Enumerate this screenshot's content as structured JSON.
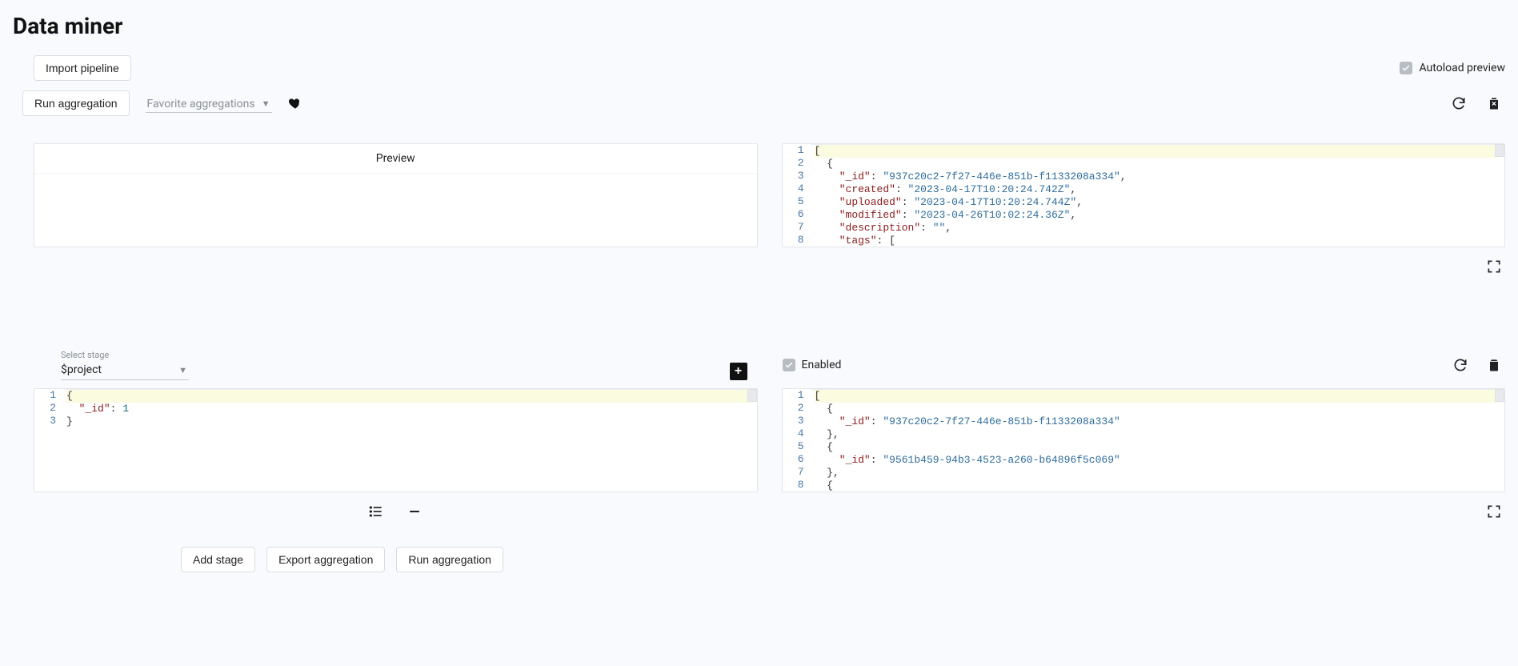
{
  "page_title": "Data miner",
  "toolbar": {
    "import_label": "Import pipeline",
    "run_label": "Run aggregation",
    "fav_placeholder": "Favorite aggregations",
    "autoload_label": "Autoload preview",
    "autoload_checked": true
  },
  "preview_panel": {
    "header": "Preview"
  },
  "result_preview_code": {
    "lines": [
      {
        "n": 1,
        "t": "[",
        "indent": 0
      },
      {
        "n": 2,
        "t": "{",
        "indent": 1
      },
      {
        "n": 3,
        "key": "_id",
        "val": "937c20c2-7f27-446e-851b-f1133208a334",
        "comma": true,
        "indent": 2
      },
      {
        "n": 4,
        "key": "created",
        "val": "2023-04-17T10:20:24.742Z",
        "comma": true,
        "indent": 2
      },
      {
        "n": 5,
        "key": "uploaded",
        "val": "2023-04-17T10:20:24.744Z",
        "comma": true,
        "indent": 2
      },
      {
        "n": 6,
        "key": "modified",
        "val": "2023-04-26T10:02:24.36Z",
        "comma": true,
        "indent": 2
      },
      {
        "n": 7,
        "key": "description",
        "val": "",
        "comma": true,
        "indent": 2
      },
      {
        "n": 8,
        "key": "tags",
        "raw": "[",
        "indent": 2
      }
    ]
  },
  "stage": {
    "select_label": "Select stage",
    "selected": "$project",
    "enabled_label": "Enabled",
    "enabled_checked": true,
    "editor_code": {
      "lines": [
        {
          "n": 1,
          "t": "{",
          "indent": 0
        },
        {
          "n": 2,
          "key": "_id",
          "num": 1,
          "indent": 1
        },
        {
          "n": 3,
          "t": "}",
          "indent": 0
        }
      ]
    },
    "result_code": {
      "lines": [
        {
          "n": 1,
          "t": "[",
          "indent": 0
        },
        {
          "n": 2,
          "t": "{",
          "indent": 1
        },
        {
          "n": 3,
          "key": "_id",
          "val": "937c20c2-7f27-446e-851b-f1133208a334",
          "indent": 2
        },
        {
          "n": 4,
          "t": "},",
          "indent": 1
        },
        {
          "n": 5,
          "t": "{",
          "indent": 1
        },
        {
          "n": 6,
          "key": "_id",
          "val": "9561b459-94b3-4523-a260-b64896f5c069",
          "indent": 2
        },
        {
          "n": 7,
          "t": "},",
          "indent": 1
        },
        {
          "n": 8,
          "t": "{",
          "indent": 1
        }
      ]
    }
  },
  "bottom": {
    "add_stage": "Add stage",
    "export": "Export aggregation",
    "run": "Run aggregation"
  }
}
